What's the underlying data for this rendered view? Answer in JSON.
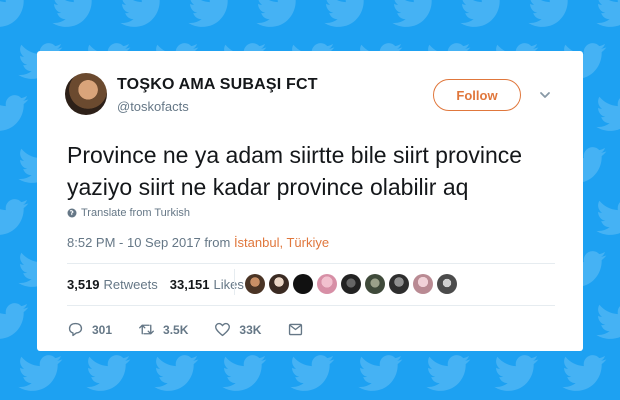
{
  "tweet": {
    "display_name": "TOŞKO AMA SUBAŞI FCT",
    "handle": "@toskofacts",
    "follow_label": "Follow",
    "text": "Province ne ya adam siirtte bile siirt province\nyaziyo siirt ne kadar province olabilir aq",
    "translate_label": "Translate from Turkish",
    "timestamp": "8:52 PM - 10 Sep 2017 from ",
    "location": "İstanbul, Türkiye",
    "retweets_count": "3,519",
    "retweets_label": "Retweets",
    "likes_count": "33,151",
    "likes_label": "Likes",
    "reply_count": "301",
    "retweet_action_count": "3.5K",
    "like_action_count": "33K"
  },
  "colors": {
    "background": "#1da1f2",
    "accent": "#e0773c",
    "text": "#14171a",
    "muted": "#657786"
  },
  "icons": [
    "twitter-bird-icon",
    "chevron-down-icon",
    "globe-icon",
    "reply-icon",
    "retweet-icon",
    "heart-icon",
    "message-icon"
  ]
}
